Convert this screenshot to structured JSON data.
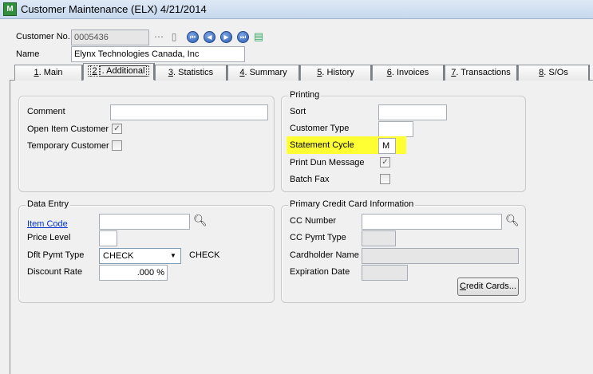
{
  "window": {
    "title": "Customer Maintenance (ELX) 4/21/2014",
    "app_icon_letter": "M"
  },
  "header": {
    "customer_no_label": "Customer No.",
    "customer_no_value": "0005436",
    "name_label": "Name",
    "name_value": "Elynx Technologies Canada, Inc"
  },
  "tabs": [
    {
      "num": "1",
      "label": ". Main"
    },
    {
      "num": "2",
      "label": ". Additional"
    },
    {
      "num": "3",
      "label": ". Statistics"
    },
    {
      "num": "4",
      "label": ". Summary"
    },
    {
      "num": "5",
      "label": ". History"
    },
    {
      "num": "6",
      "label": ". Invoices"
    },
    {
      "num": "7",
      "label": ". Transactions"
    },
    {
      "num": "8",
      "label": ". S/Os"
    }
  ],
  "general": {
    "comment_label": "Comment",
    "comment_value": "",
    "open_item_label": "Open Item Customer",
    "open_item_checked": true,
    "temporary_label": "Temporary Customer",
    "temporary_checked": false
  },
  "printing": {
    "title": "Printing",
    "sort_label": "Sort",
    "sort_value": "",
    "customer_type_label": "Customer Type",
    "customer_type_value": "",
    "statement_cycle_label": "Statement Cycle",
    "statement_cycle_value": "M",
    "print_dun_label": "Print Dun Message",
    "print_dun_checked": true,
    "batch_fax_label": "Batch Fax",
    "batch_fax_checked": false
  },
  "data_entry": {
    "title": "Data Entry",
    "item_code_label": "Item Code",
    "item_code_value": "",
    "price_level_label": "Price Level",
    "price_level_value": "",
    "dflt_pymt_label": "Dflt Pymt Type",
    "dflt_pymt_value": "CHECK",
    "dflt_pymt_desc": "CHECK",
    "discount_label": "Discount Rate",
    "discount_value": ".000 %"
  },
  "credit_card": {
    "title": "Primary Credit Card Information",
    "cc_number_label": "CC Number",
    "cc_pymt_type_label": "CC Pymt Type",
    "cardholder_label": "Cardholder Name",
    "expiration_label": "Expiration Date",
    "credit_cards_button_u": "C",
    "credit_cards_button": "redit Cards..."
  },
  "colors": {
    "highlight": "#ffff33",
    "link": "#0033cc"
  }
}
